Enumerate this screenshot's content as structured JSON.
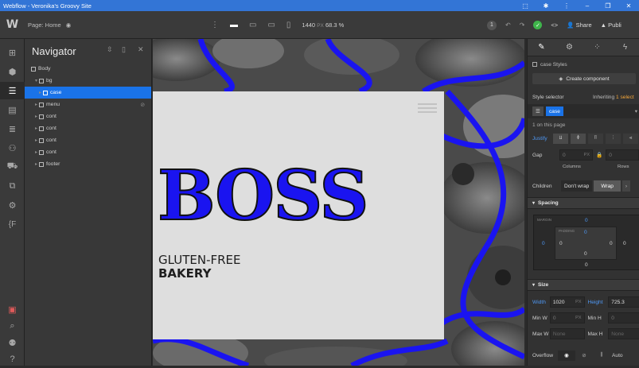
{
  "window": {
    "title": "Webflow - Veronika's Groovy Site"
  },
  "topbar": {
    "logo": "W",
    "page_label": "Page: Home",
    "width_value": "1440",
    "width_unit": "PX",
    "zoom": "68.3 %",
    "badge_count": "1",
    "share_label": "Share",
    "publish_label": "Publi"
  },
  "navigator": {
    "title": "Navigator",
    "items": [
      {
        "label": "Body",
        "depth": 0,
        "kind": "body"
      },
      {
        "label": "bg",
        "depth": 1,
        "kind": "box"
      },
      {
        "label": "case",
        "depth": 2,
        "kind": "box",
        "selected": true
      },
      {
        "label": "menu",
        "depth": 1,
        "kind": "box"
      },
      {
        "label": "cont",
        "depth": 1,
        "kind": "box"
      },
      {
        "label": "cont",
        "depth": 1,
        "kind": "box"
      },
      {
        "label": "cont",
        "depth": 1,
        "kind": "box"
      },
      {
        "label": "cont",
        "depth": 1,
        "kind": "box"
      },
      {
        "label": "footer",
        "depth": 1,
        "kind": "box"
      }
    ]
  },
  "canvas": {
    "logo_text": "BOSS",
    "tagline_line1": "GLUTEN-FREE",
    "tagline_line2": "BAKERY",
    "accent": "#1a14f0",
    "card_bg": "#dedede"
  },
  "style_panel": {
    "element_styles": "case Styles",
    "create_component": "Create component",
    "style_selector_label": "Style selector",
    "inheriting_prefix": "Inheriting",
    "inheriting_count": "1",
    "inheriting_suffix": "select",
    "selector_chip": "case",
    "on_page": "1 on this page",
    "justify_label": "Justify",
    "gap_label": "Gap",
    "gap_value": "0",
    "gap_unit": "PX",
    "gap_value2": "0",
    "columns_label": "Columns",
    "rows_label": "Rows",
    "children_label": "Children",
    "dont_wrap": "Don't wrap",
    "wrap": "Wrap",
    "spacing_title": "Spacing",
    "margin_label": "MARGIN",
    "padding_label": "PADDING",
    "margin_top": "0",
    "margin_left": "0",
    "margin_right": "0",
    "margin_bottom": "0",
    "padding_top": "0",
    "padding_left": "0",
    "padding_right": "0",
    "padding_bottom": "0",
    "size_title": "Size",
    "width_label": "Width",
    "width_value": "1020",
    "width_unit": "PX",
    "height_label": "Height",
    "height_value": "725.3",
    "minw_label": "Min W",
    "minw_value": "0",
    "minw_unit": "PX",
    "minh_label": "Min H",
    "minh_value": "0",
    "maxw_label": "Max W",
    "maxw_value": "None",
    "maxh_label": "Max H",
    "maxh_value": "None",
    "overflow_label": "Overflow",
    "overflow_auto": "Auto"
  }
}
